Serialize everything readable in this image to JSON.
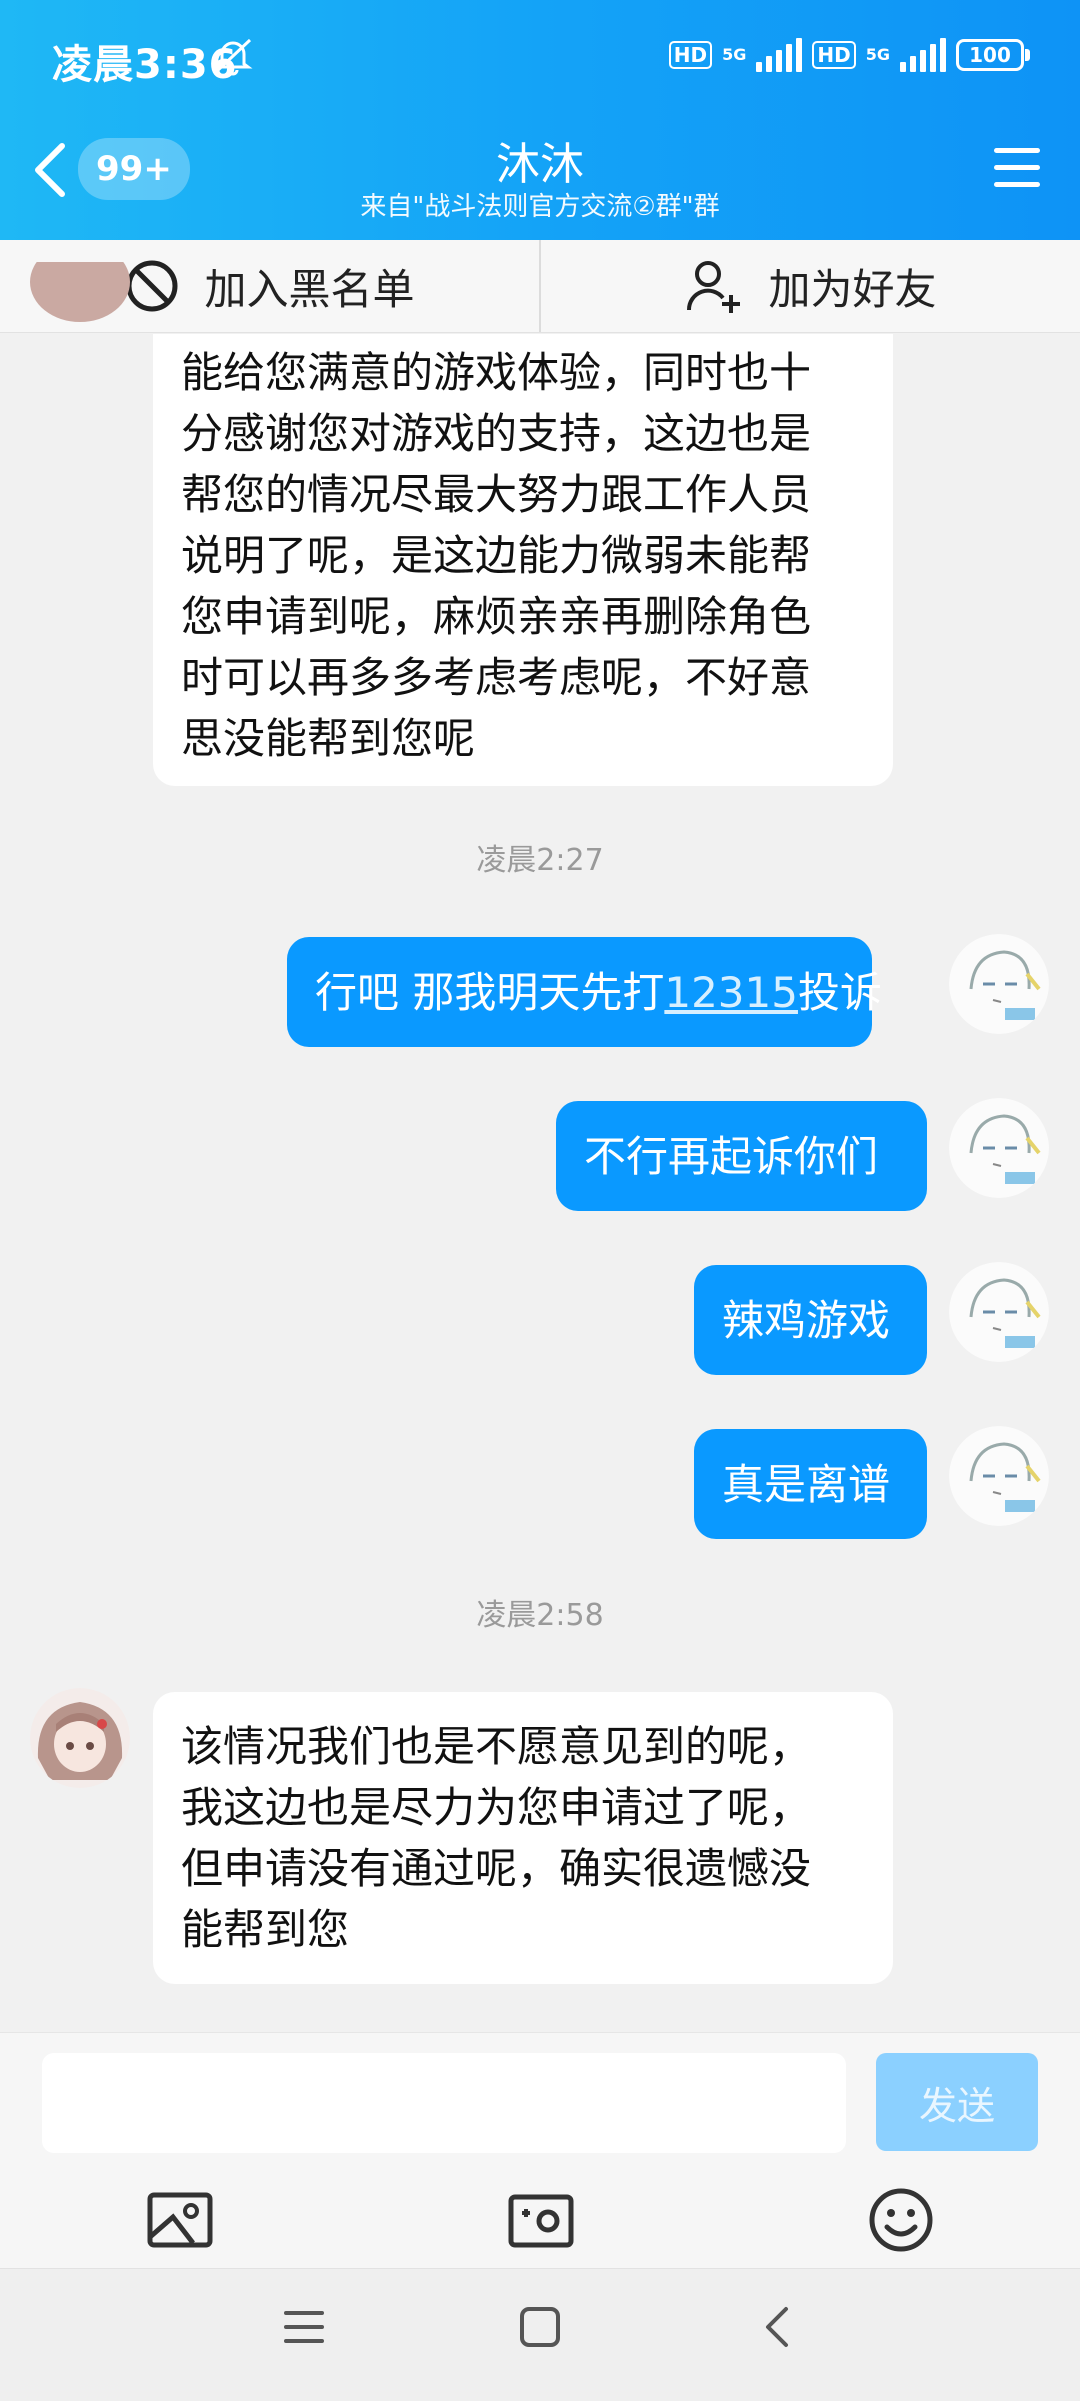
{
  "status_bar": {
    "time": "凌晨3:36",
    "hd1": "HD",
    "net1": "5G",
    "hd2": "HD",
    "net2": "5G",
    "battery": "100"
  },
  "header": {
    "unread_count": "99+",
    "title": "沐沐",
    "subtitle": "来自\"战斗法则官方交流②群\"群"
  },
  "actions": {
    "block_label": "加入黑名单",
    "add_friend_label": "加为好友"
  },
  "messages": {
    "incoming1": {
      "lines": [
        "能给您满意的游戏体验，同时也十",
        "分感谢您对游戏的支持，这边也是",
        "帮您的情况尽最大努力跟工作人员",
        "说明了呢，是这边能力微弱未能帮",
        "您申请到呢，麻烦亲亲再删除角色",
        "时可以再多多考虑考虑呢，不好意",
        "思没能帮到您呢"
      ]
    },
    "time1": "凌晨2:27",
    "out1": {
      "before": "行吧 那我明天先打",
      "link": "12315",
      "after": "投诉"
    },
    "out2": "不行再起诉你们",
    "out3": "辣鸡游戏",
    "out4": "真是离谱",
    "time2": "凌晨2:58",
    "incoming2": {
      "lines": [
        "该情况我们也是不愿意见到的呢，",
        "我这边也是尽力为您申请过了呢，",
        "但申请没有通过呢，确实很遗憾没",
        "能帮到您"
      ]
    }
  },
  "input": {
    "placeholder": "",
    "send_label": "发送"
  },
  "icons": {
    "back": "chevron-left-icon",
    "menu": "hamburger-menu-icon",
    "block": "prohibit-icon",
    "add_friend": "add-person-icon",
    "photo": "image-icon",
    "camera": "camera-icon",
    "emoji": "emoji-icon"
  },
  "colors": {
    "accent": "#0a99ff",
    "header_start": "#1fb8f5",
    "send_disabled": "#8bd0ff"
  }
}
